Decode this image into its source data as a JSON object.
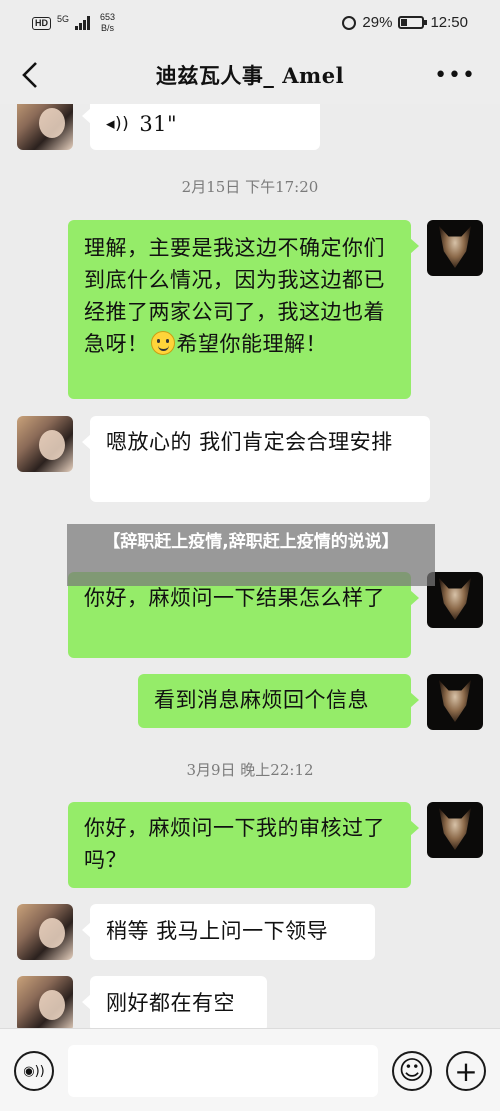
{
  "status": {
    "network": "HD",
    "signal": "5G",
    "speed_value": "653",
    "speed_unit": "B/s",
    "battery": "29%",
    "time": "12:50"
  },
  "header": {
    "title": "迪兹瓦人事_ Amel",
    "back_icon": "chevron-left-icon",
    "more_icon": "more-dots-icon",
    "more_label": "•••"
  },
  "messages": [
    {
      "side": "in",
      "type": "voice",
      "duration": "31\""
    },
    {
      "side": "timestamp",
      "text": "2月15日 下午17:20"
    },
    {
      "side": "out",
      "text_before_emoji": "理解，主要是我这边不确定你们到底什么情况，因为我这边都已经推了两家公司了，我这边也着急呀！",
      "text_after_emoji": "希望你能理解！"
    },
    {
      "side": "in",
      "text": "嗯放心的 我们肯定会合理安排"
    },
    {
      "side": "out",
      "text": "你好，麻烦问一下结果怎么样了"
    },
    {
      "side": "out",
      "text": "看到消息麻烦回个信息"
    },
    {
      "side": "timestamp",
      "text": "3月9日 晚上22:12"
    },
    {
      "side": "out",
      "text": "你好，麻烦问一下我的审核过了吗？"
    },
    {
      "side": "in",
      "text": "稍等 我马上问一下领导"
    },
    {
      "side": "in",
      "text": "刚好都在有空"
    }
  ],
  "overlay": {
    "text": "【辞职赶上疫情,辞职赶上疫情的说说】"
  },
  "input_bar": {
    "voice_icon": "voice-icon",
    "emoji_icon": "emoji-icon",
    "plus_icon": "plus-icon",
    "voice_glyph": "◉))",
    "emoji_glyph": "☺",
    "plus_glyph": "+"
  }
}
